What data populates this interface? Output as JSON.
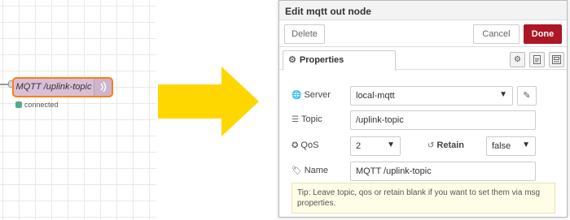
{
  "canvas": {
    "node_label": "MQTT /uplink-topic",
    "node_icon": "wifi-icon",
    "status_text": "connected",
    "colors": {
      "node_fill": "#d8bfd8",
      "node_border": "#ff7f0e",
      "status": "#5aa88a"
    }
  },
  "arrow": {
    "color": "#ffd700",
    "icon": "arrow-right-icon"
  },
  "dialog": {
    "title": "Edit mqtt out node",
    "delete_label": "Delete",
    "cancel_label": "Cancel",
    "done_label": "Done",
    "tab_label": "Properties",
    "accent": "#ad1625",
    "fields": {
      "server": {
        "label": "Server",
        "value": "local-mqtt"
      },
      "topic": {
        "label": "Topic",
        "value": "/uplink-topic"
      },
      "qos": {
        "label": "QoS",
        "value": "2"
      },
      "retain": {
        "label": "Retain",
        "value": "false"
      },
      "name": {
        "label": "Name",
        "value": "MQTT /uplink-topic"
      }
    },
    "tip": "Tip: Leave topic, qos or retain blank if you want to set them via msg properties."
  }
}
